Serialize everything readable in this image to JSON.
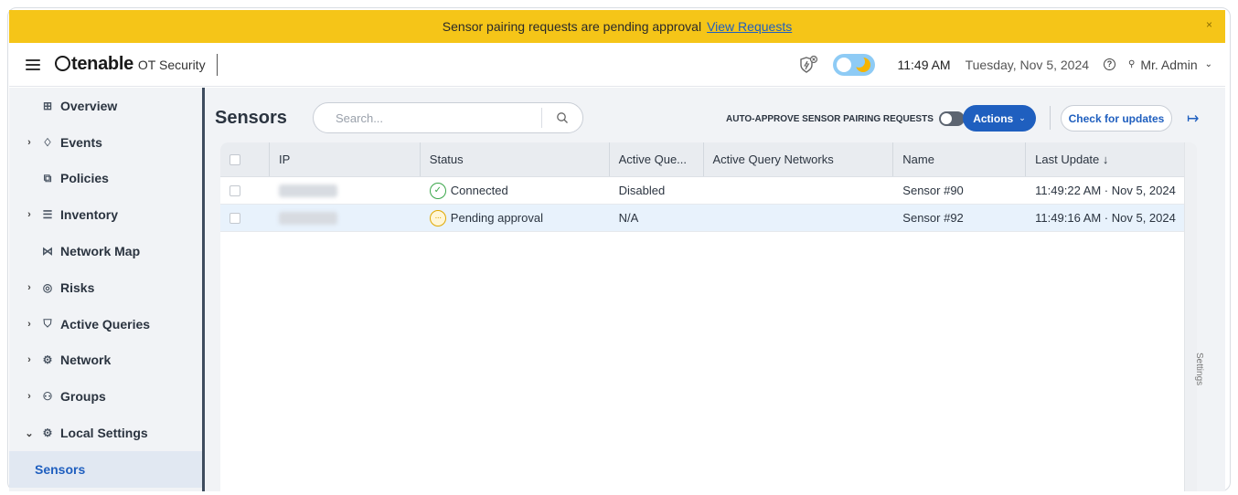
{
  "banner": {
    "message": "Sensor pairing requests are pending approval",
    "link": "View Requests",
    "close": "×",
    "color": "#f5c518"
  },
  "topbar": {
    "brand": "tenable",
    "product": "OT Security",
    "time": "11:49 AM",
    "date": "Tuesday, Nov 5, 2024",
    "user": "Mr. Admin",
    "icons": [
      "menu-icon",
      "shield-icon",
      "theme-toggle",
      "help-icon",
      "user-icon",
      "chevron-down-icon"
    ]
  },
  "sidebar": {
    "items": [
      {
        "label": "Overview",
        "icon": "⊞",
        "expandable": false
      },
      {
        "label": "Events",
        "icon": "🔔",
        "expandable": true
      },
      {
        "label": "Policies",
        "icon": "⧉",
        "expandable": false
      },
      {
        "label": "Inventory",
        "icon": "☰",
        "expandable": true
      },
      {
        "label": "Network Map",
        "icon": "⋈",
        "expandable": false
      },
      {
        "label": "Risks",
        "icon": "◎",
        "expandable": true
      },
      {
        "label": "Active Queries",
        "icon": "⛉",
        "expandable": true
      },
      {
        "label": "Network",
        "icon": "⚙",
        "expandable": true
      },
      {
        "label": "Groups",
        "icon": "⚇",
        "expandable": true
      },
      {
        "label": "Local Settings",
        "icon": "⚙",
        "expandable": true,
        "expanded": true
      },
      {
        "label": "Sensors",
        "active": true
      }
    ]
  },
  "main": {
    "title": "Sensors",
    "search_placeholder": "Search...",
    "auto_approve_label": "AUTO-APPROVE SENSOR PAIRING REQUESTS",
    "auto_approve_on": false,
    "actions_label": "Actions",
    "check_updates_label": "Check for updates",
    "settings_tab": "Settings",
    "accent": "#1f5fbf"
  },
  "table": {
    "columns": [
      "IP",
      "Status",
      "Active Que...",
      "Active Query Networks",
      "Name",
      "Last Update ↓"
    ],
    "rows": [
      {
        "ip": "",
        "status": "Connected",
        "status_kind": "ok",
        "active_queries": "Disabled",
        "networks": "",
        "name": "Sensor #90",
        "last_update": "11:49:22 AM · Nov 5, 2024",
        "selected": false
      },
      {
        "ip": "",
        "status": "Pending approval",
        "status_kind": "pending",
        "active_queries": "N/A",
        "networks": "",
        "name": "Sensor #92",
        "last_update": "11:49:16 AM · Nov 5, 2024",
        "selected": true
      }
    ]
  }
}
